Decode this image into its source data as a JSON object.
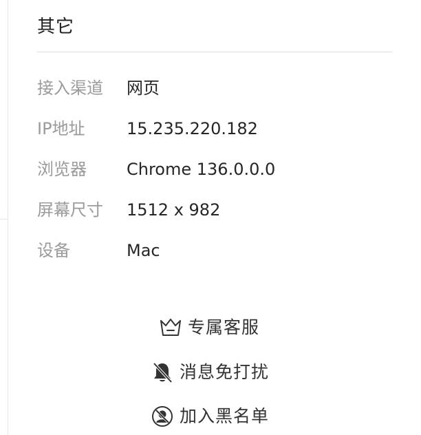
{
  "section": {
    "title": "其它"
  },
  "info": [
    {
      "label": "接入渠道",
      "value": "网页"
    },
    {
      "label": "IP地址",
      "value": "15.235.220.182"
    },
    {
      "label": "浏览器",
      "value": "Chrome 136.0.0.0"
    },
    {
      "label": "屏幕尺寸",
      "value": "1512 x 982"
    },
    {
      "label": "设备",
      "value": "Mac"
    }
  ],
  "actions": [
    {
      "label": "专属客服",
      "icon": "crown-icon"
    },
    {
      "label": "消息免打扰",
      "icon": "bell-muted-icon"
    },
    {
      "label": "加入黑名单",
      "icon": "user-block-icon"
    }
  ]
}
